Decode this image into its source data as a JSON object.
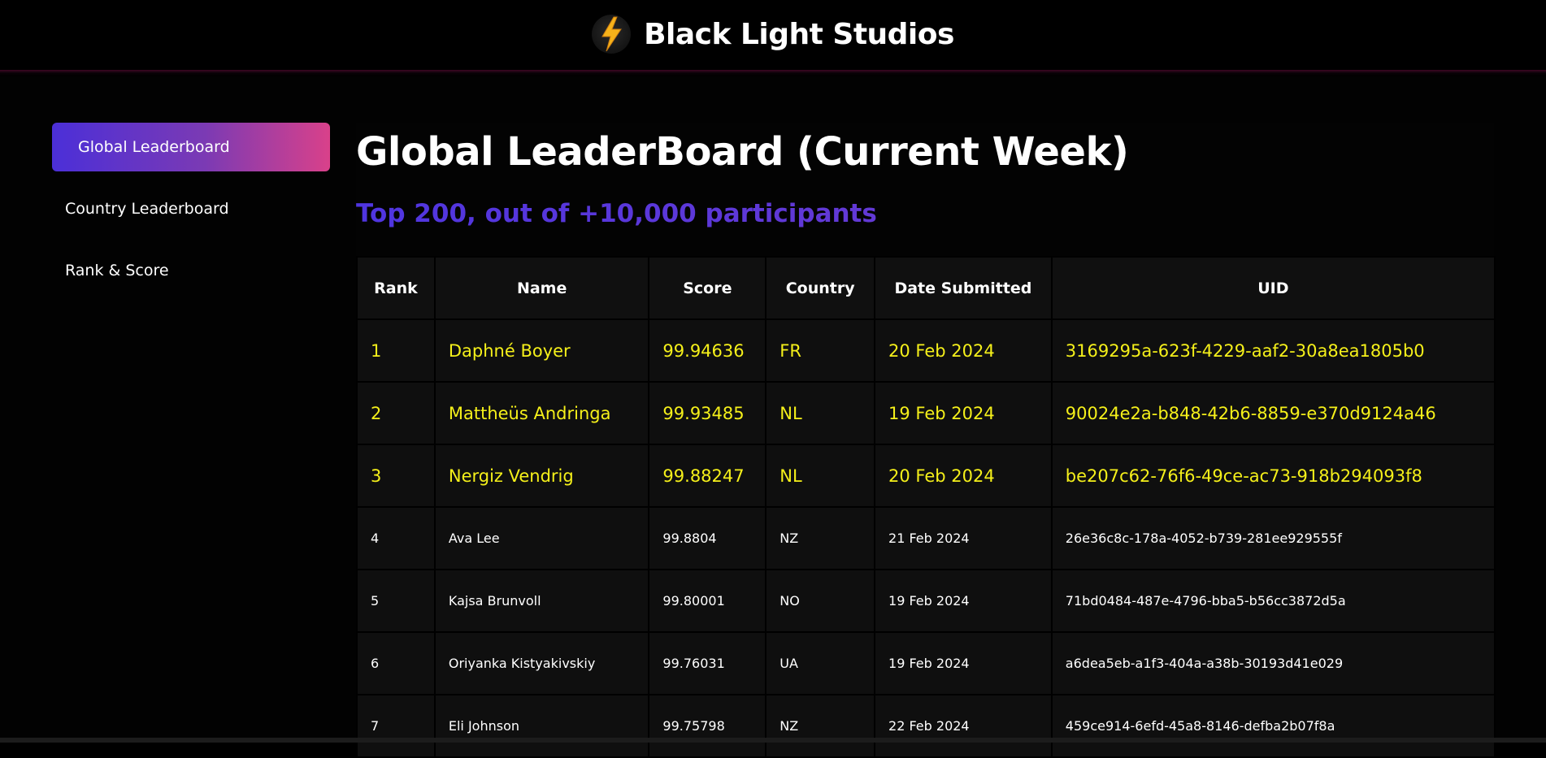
{
  "header": {
    "logo_icon": "lightning-bolt-icon",
    "brand_name": "Black Light Studios"
  },
  "sidebar": {
    "items": [
      {
        "label": "Global Leaderboard",
        "active": true
      },
      {
        "label": "Country Leaderboard",
        "active": false
      },
      {
        "label": "Rank & Score",
        "active": false
      }
    ]
  },
  "main": {
    "title": "Global LeaderBoard (Current Week)",
    "subtitle": "Top 200, out of +10,000 participants"
  },
  "table": {
    "columns": [
      "Rank",
      "Name",
      "Score",
      "Country",
      "Date Submitted",
      "UID"
    ],
    "rows": [
      {
        "rank": "1",
        "name": "Daphné Boyer",
        "score": "99.94636",
        "country": "FR",
        "date": "20 Feb 2024",
        "uid": "3169295a-623f-4229-aaf2-30a8ea1805b0"
      },
      {
        "rank": "2",
        "name": "Mattheüs Andringa",
        "score": "99.93485",
        "country": "NL",
        "date": "19 Feb 2024",
        "uid": "90024e2a-b848-42b6-8859-e370d9124a46"
      },
      {
        "rank": "3",
        "name": "Nergiz Vendrig",
        "score": "99.88247",
        "country": "NL",
        "date": "20 Feb 2024",
        "uid": "be207c62-76f6-49ce-ac73-918b294093f8"
      },
      {
        "rank": "4",
        "name": "Ava Lee",
        "score": "99.8804",
        "country": "NZ",
        "date": "21 Feb 2024",
        "uid": "26e36c8c-178a-4052-b739-281ee929555f"
      },
      {
        "rank": "5",
        "name": "Kajsa Brunvoll",
        "score": "99.80001",
        "country": "NO",
        "date": "19 Feb 2024",
        "uid": "71bd0484-487e-4796-bba5-b56cc3872d5a"
      },
      {
        "rank": "6",
        "name": "Oriyanka Kistyakivskiy",
        "score": "99.76031",
        "country": "UA",
        "date": "19 Feb 2024",
        "uid": "a6dea5eb-a1f3-404a-a38b-30193d41e029"
      },
      {
        "rank": "7",
        "name": "Eli Johnson",
        "score": "99.75798",
        "country": "NZ",
        "date": "22 Feb 2024",
        "uid": "459ce914-6efd-45a8-8146-defba2b07f8a"
      }
    ]
  },
  "colors": {
    "top_rank_text": "#f5f01a",
    "accent_start": "#4b2fd8",
    "accent_end": "#d9418a"
  }
}
